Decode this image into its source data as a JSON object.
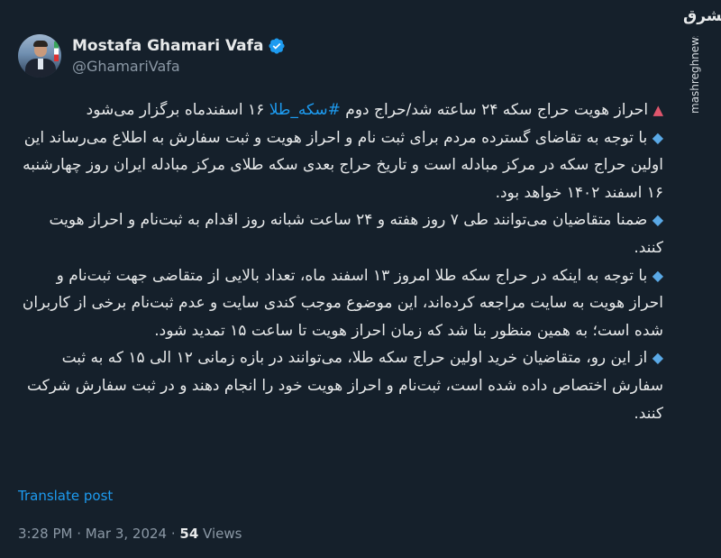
{
  "watermark": {
    "logo": "مشرق",
    "site": "mashreghnews.ir"
  },
  "author": {
    "display_name": "Mostafa Ghamari Vafa",
    "handle": "@GhamariVafa",
    "verified_color": "#1d9bf0"
  },
  "tweet": {
    "p1_pre": "احراز هویت حراج سکه ۲۴ ساعته شد/حراج دوم ",
    "p1_hashtag": "#سکه_طلا",
    "p1_post": " ۱۶ اسفندماه برگزار می‌شود",
    "p2": "با توجه به تقاضای گسترده مردم برای ثبت نام و احراز هویت و ثبت سفارش به اطلاع می‌رساند این اولین حراج سکه در مرکز مبادله است و تاریخ حراج بعدی سکه طلای مرکز مبادله ایران روز چهارشنبه ۱۶ اسفند ۱۴۰۲ خواهد بود.",
    "p3": "ضمنا متقاضیان می‌توانند طی ۷ روز هفته و ۲۴ ساعت شبانه روز اقدام به ثبت‌نام و احراز هویت کنند.",
    "p4": "با توجه به اینکه در حراج سکه طلا امروز ۱۳ اسفند ماه، تعداد بالایی از متقاضی جهت ثبت‌نام و احراز هویت به سایت مراجعه کرده‌اند، این موضوع موجب کندی سایت و عدم ثبت‌نام برخی از کاربران شده است؛ به همین منظور بنا شد که زمان احراز هویت تا ساعت ۱۵ تمدید شود.",
    "p5": "از این رو، متقاضیان خرید اولین حراج سکه طلا، می‌توانند در بازه زمانی ۱۲ الی ۱۵ که به ثبت سفارش اختصاص داده شده است، ثبت‌نام و احراز هویت خود را انجام دهند و در ثبت سفارش شرکت کنند."
  },
  "icons": {
    "triangle": "▲",
    "diamond": "◆"
  },
  "actions": {
    "translate_label": "Translate post"
  },
  "meta": {
    "time": "3:28 PM",
    "separator": " · ",
    "date": "Mar 3, 2024",
    "views_count": "54",
    "views_label": " Views"
  },
  "colors": {
    "background": "#15202b",
    "link": "#1d9bf0",
    "secondary": "#8b98a5",
    "text": "#e7e9ea"
  }
}
